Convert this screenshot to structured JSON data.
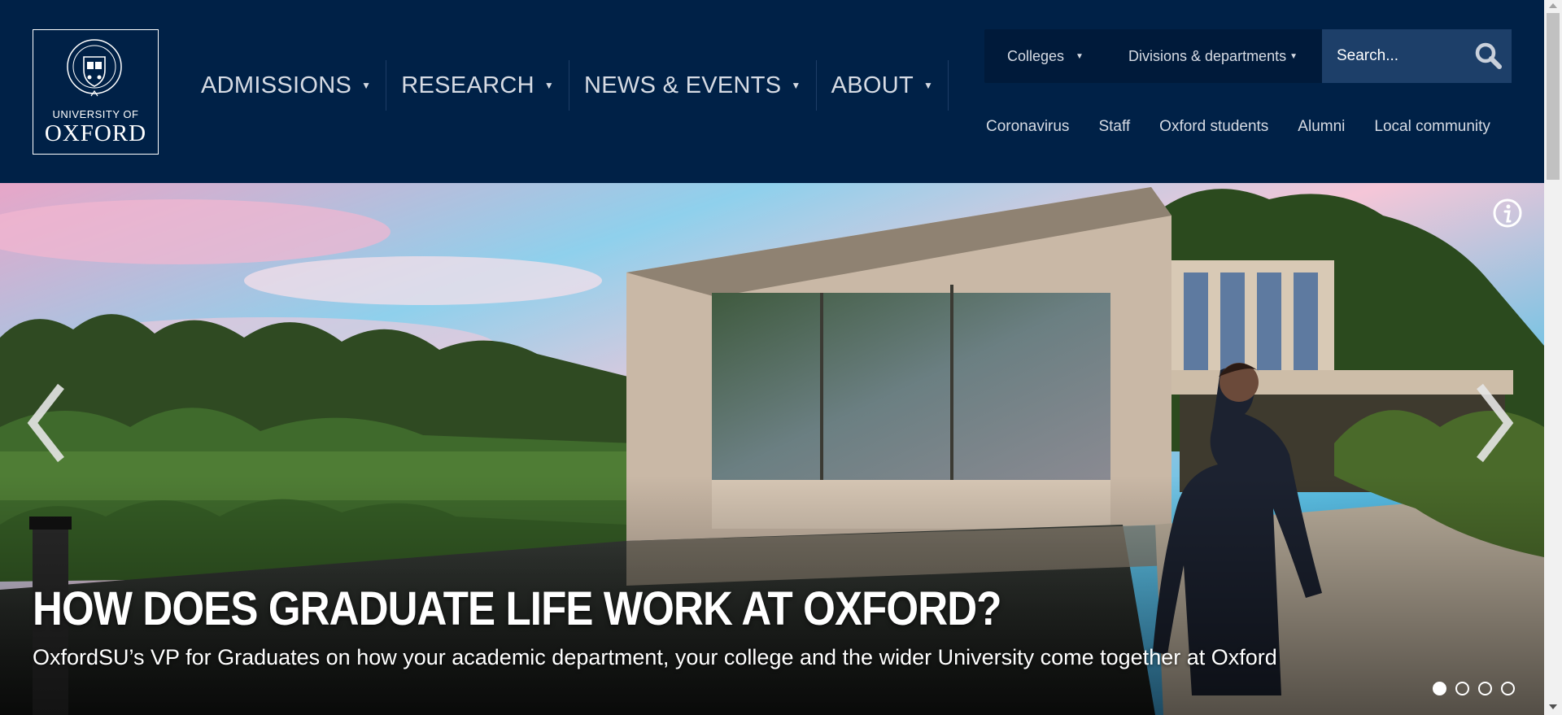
{
  "logo": {
    "line1": "UNIVERSITY OF",
    "line2": "OXFORD"
  },
  "main_nav": [
    {
      "label": "ADMISSIONS"
    },
    {
      "label": "RESEARCH"
    },
    {
      "label": "NEWS & EVENTS"
    },
    {
      "label": "ABOUT"
    }
  ],
  "toolbar": {
    "colleges_label": "Colleges",
    "divisions_label": "Divisions & departments",
    "search_placeholder": "Search..."
  },
  "quick_links": [
    {
      "label": "Coronavirus"
    },
    {
      "label": "Staff"
    },
    {
      "label": "Oxford students"
    },
    {
      "label": "Alumni"
    },
    {
      "label": "Local community"
    }
  ],
  "hero": {
    "headline": "HOW DOES GRADUATE LIFE WORK AT OXFORD?",
    "subtitle": "OxfordSU’s VP for Graduates on how your academic department, your college and the wider University come together at Oxford",
    "slide_count": 4,
    "active_slide": 1
  },
  "colors": {
    "brand_navy": "#002147",
    "toolbar_dark": "#001a3a",
    "search_bg": "#1d3f69",
    "nav_text": "#d6dbe4"
  },
  "icons": [
    "crest-icon",
    "caret-down-icon",
    "search-icon",
    "info-icon",
    "chevron-left-icon",
    "chevron-right-icon"
  ]
}
